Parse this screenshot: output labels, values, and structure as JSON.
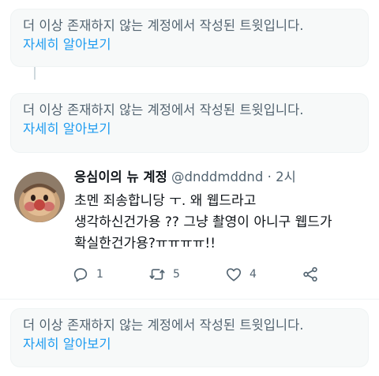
{
  "notices": [
    {
      "text": "더 이상 존재하지 않는 계정에서 작성된 트윗입니다.",
      "link": "자세히 알아보기"
    },
    {
      "text": "더 이상 존재하지 않는 계정에서 작성된 트윗입니다.",
      "link": "자세히 알아보기"
    },
    {
      "text": "더 이상 존재하지 않는 계정에서 작성된 트윗입니다.",
      "link": "자세히 알아보기"
    }
  ],
  "tweet": {
    "display_name": "응심이의 뉴 계정",
    "handle": "@dnddmddnd",
    "separator": "·",
    "time": "2시",
    "body_lines": [
      "초멘 죄송합니당 ㅜ. 왜 웹드라고",
      "생각하신건가용 ?? 그냥 촬영이 아니구 웹드가",
      "확실한건가용?ㅠㅠㅠㅠ!!"
    ],
    "actions": {
      "reply": {
        "icon": "reply-icon",
        "count": "1"
      },
      "retweet": {
        "icon": "retweet-icon",
        "count": "5"
      },
      "like": {
        "icon": "heart-icon",
        "count": "4"
      },
      "share": {
        "icon": "share-icon"
      }
    }
  },
  "colors": {
    "link": "#1d9bf0",
    "secondary_text": "#536471",
    "notice_background": "#f7f9f9",
    "thread_line": "#cfd9de"
  }
}
